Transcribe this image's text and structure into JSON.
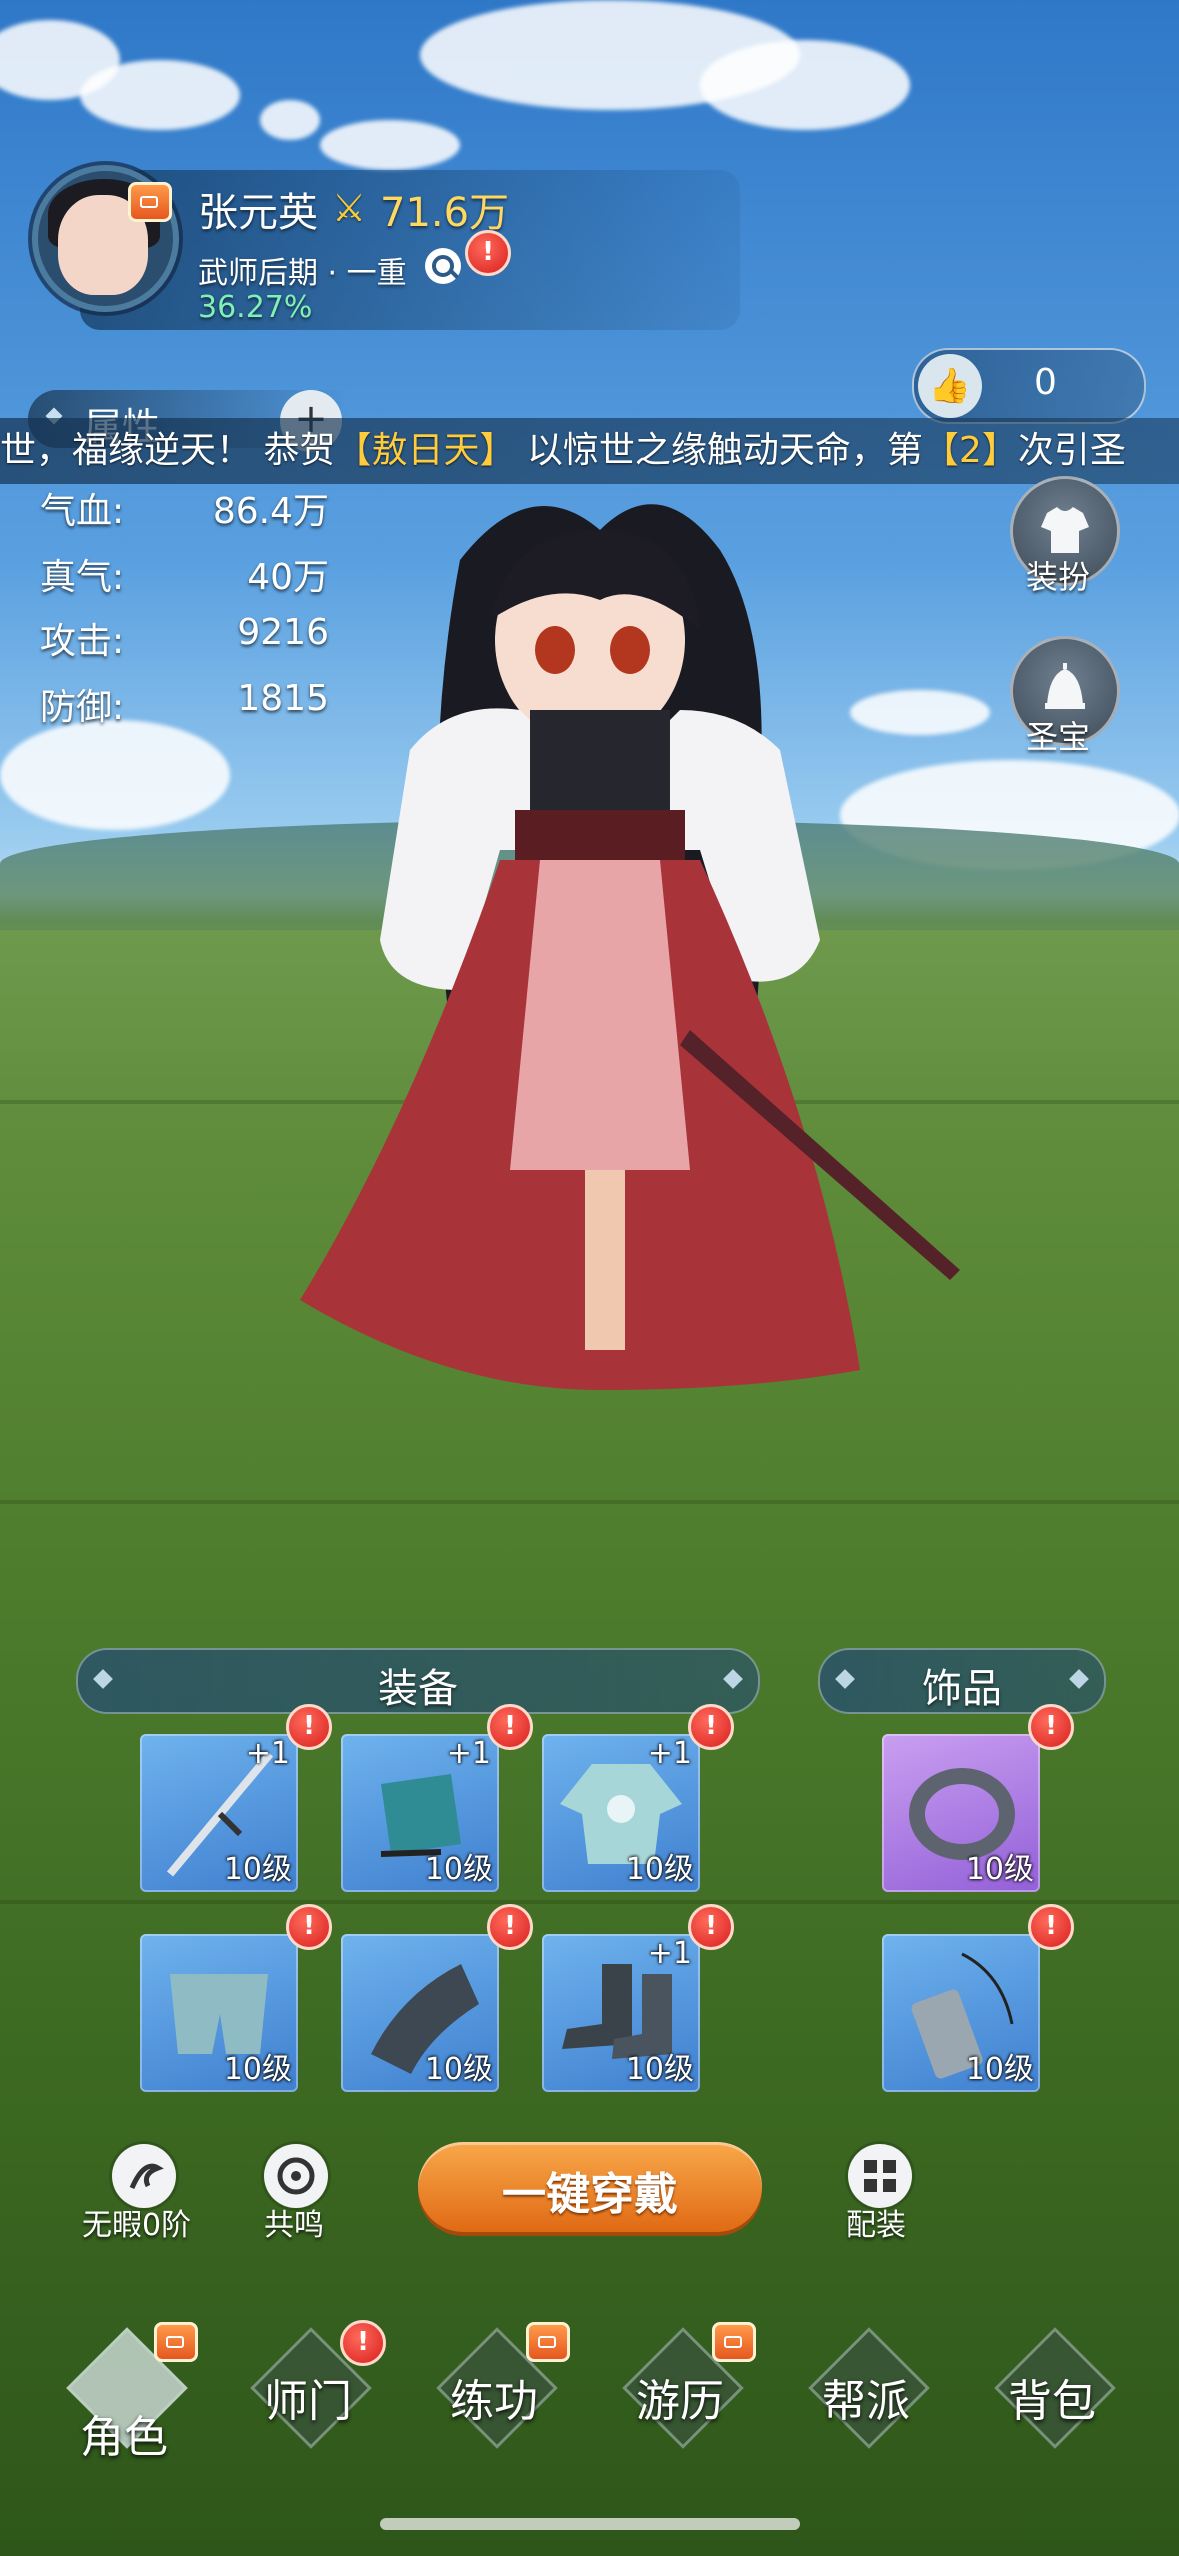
{
  "player": {
    "name": "张元英",
    "power": "71.6万",
    "rank": "武师后期 · 一重",
    "progress_text": "36.27%"
  },
  "likes": {
    "count": "0"
  },
  "attributes": {
    "tab_label": "属性",
    "expand_symbol": "+",
    "stats": [
      {
        "label": "气血:",
        "value": "86.4万"
      },
      {
        "label": "真气:",
        "value": "40万"
      },
      {
        "label": "攻击:",
        "value": "9216"
      },
      {
        "label": "防御:",
        "value": "1815"
      }
    ]
  },
  "ticker": {
    "part1": "世，福缘逆天！ 恭贺",
    "highlight1": "【敖日天】",
    "part2": " 以惊世之缘触动天命，第",
    "highlight2": "【2】",
    "part3": "次引圣"
  },
  "side_buttons": {
    "outfit": "装扮",
    "treasure": "圣宝"
  },
  "equipment": {
    "title": "装备",
    "slots": [
      {
        "icon": "sword-icon",
        "level": "10级",
        "plus": "+1",
        "alert": true
      },
      {
        "icon": "helmet-icon",
        "level": "10级",
        "plus": "+1",
        "alert": true
      },
      {
        "icon": "robe-icon",
        "level": "10级",
        "plus": "+1",
        "alert": true
      },
      {
        "icon": "pants-icon",
        "level": "10级",
        "plus": "",
        "alert": true
      },
      {
        "icon": "bracer-icon",
        "level": "10级",
        "plus": "",
        "alert": true
      },
      {
        "icon": "boots-icon",
        "level": "10级",
        "plus": "+1",
        "alert": true
      }
    ]
  },
  "accessories": {
    "title": "饰品",
    "slots": [
      {
        "icon": "ring-icon",
        "level": "10级",
        "alert": true
      },
      {
        "icon": "pendant-icon",
        "level": "10级",
        "alert": true
      }
    ]
  },
  "actions": {
    "flawless": "无暇0阶",
    "resonance": "共鸣",
    "wear_all": "一键穿戴",
    "loadout": "配装"
  },
  "nav": [
    "角色",
    "师门",
    "练功",
    "游历",
    "帮派",
    "背包"
  ],
  "colors": {
    "accent_orange": "#e57a1c",
    "alert_red": "#d81f1f",
    "power_gold": "#ffd861",
    "progress_green": "#7ff0b8"
  }
}
